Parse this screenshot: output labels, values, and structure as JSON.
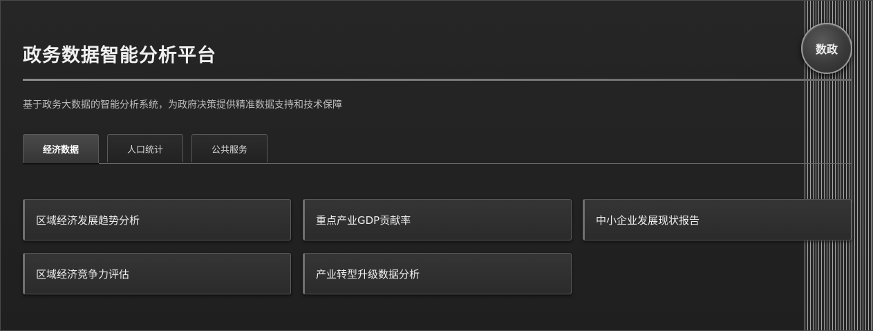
{
  "header": {
    "title": "政务数据智能分析平台",
    "badge": "数政",
    "subtitle": "基于政务大数据的智能分析系统，为政府决策提供精准数据支持和技术保障"
  },
  "tabs": [
    {
      "label": "经济数据",
      "active": true
    },
    {
      "label": "人口统计",
      "active": false
    },
    {
      "label": "公共服务",
      "active": false
    }
  ],
  "cards": [
    {
      "label": "区域经济发展趋势分析"
    },
    {
      "label": "重点产业GDP贡献率"
    },
    {
      "label": "中小企业发展现状报告"
    },
    {
      "label": "区域经济竞争力评估"
    },
    {
      "label": "产业转型升级数据分析"
    }
  ]
}
